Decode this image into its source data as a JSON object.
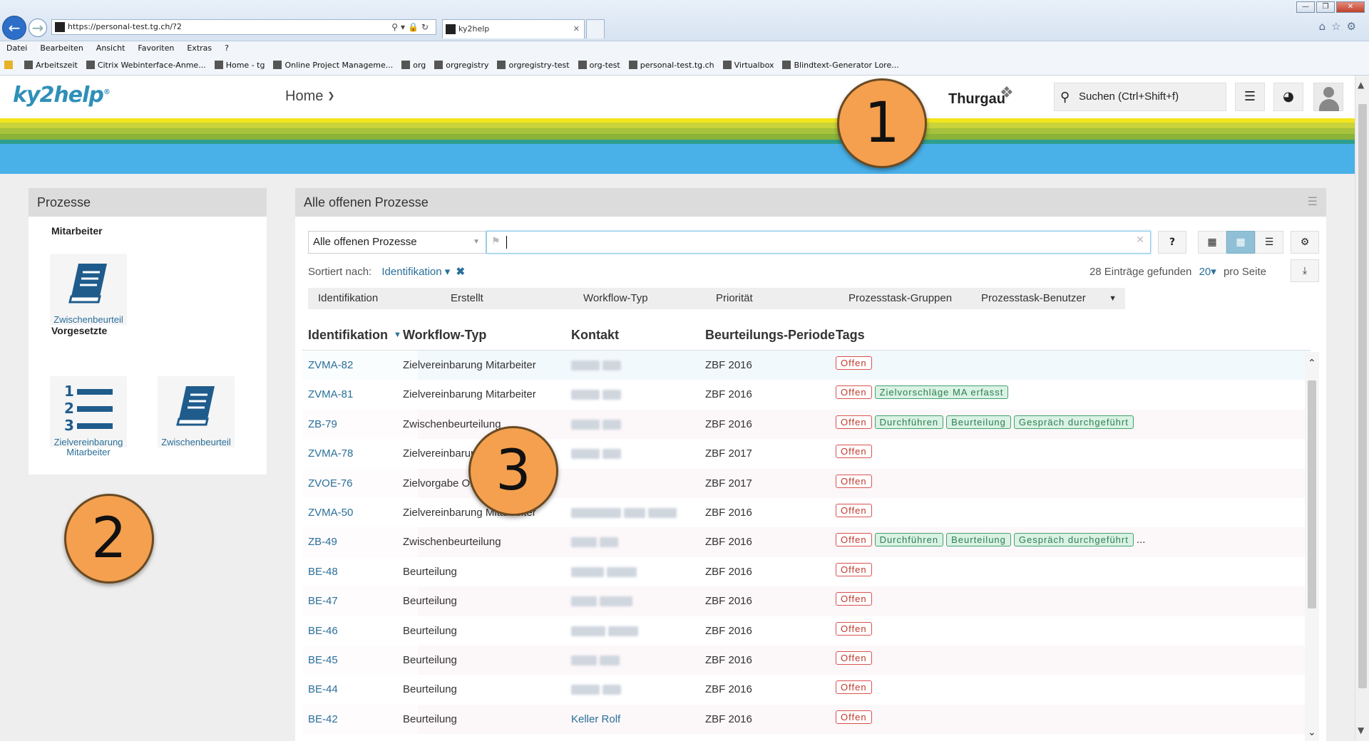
{
  "browser": {
    "url": "https://personal-test.tg.ch/?2",
    "tab_title": "ky2help",
    "menu": [
      "Datei",
      "Bearbeiten",
      "Ansicht",
      "Favoriten",
      "Extras",
      "?"
    ],
    "favorites": [
      "Arbeitszeit",
      "Citrix Webinterface-Anme...",
      "Home - tg",
      "Online Project Manageme...",
      "org",
      "orgregistry",
      "orgregistry-test",
      "org-test",
      "personal-test.tg.ch",
      "Virtualbox",
      "Blindtext-Generator Lore..."
    ]
  },
  "header": {
    "logo": "ky2help",
    "logo_reg": "®",
    "home_label": "Home",
    "brand": "Thurgau",
    "search_placeholder": "Suchen (Ctrl+Shift+f)"
  },
  "left_panel": {
    "title": "Prozesse",
    "group_employee": "Mitarbeiter",
    "group_manager": "Vorgesetzte",
    "tile_employee": "Zwischenbeurteil",
    "tile_manager_1_line1": "Zielvereinbarung",
    "tile_manager_1_line2": "Mitarbeiter",
    "tile_manager_2": "Zwischenbeurteil"
  },
  "main_panel": {
    "title": "Alle offenen Prozesse",
    "filter_value": "Alle offenen Prozesse",
    "sort_label": "Sortiert nach:",
    "sort_value": "Identifikation",
    "count_text": "28 Einträge gefunden",
    "per_page_value": "20",
    "per_page_label": "pro Seite",
    "help_btn": "?",
    "filters": [
      "Identifikation",
      "Erstellt",
      "Workflow-Typ",
      "Priorität",
      "Prozesstask-Gruppen",
      "Prozesstask-Benutzer"
    ],
    "columns": [
      "Identifikation",
      "Workflow-Typ",
      "Kontakt",
      "Beurteilungs-Periode",
      "Tags"
    ],
    "rows": [
      {
        "id": "ZVMA-82",
        "type": "Zielvereinbarung Mitarbeiter",
        "contact": "",
        "period": "ZBF 2016",
        "tags": [
          "Offen"
        ]
      },
      {
        "id": "ZVMA-81",
        "type": "Zielvereinbarung Mitarbeiter",
        "contact": "",
        "period": "ZBF 2016",
        "tags": [
          "Offen",
          "Zielvorschläge MA erfasst"
        ]
      },
      {
        "id": "ZB-79",
        "type": "Zwischenbeurteilung",
        "contact": "",
        "period": "ZBF 2016",
        "tags": [
          "Offen",
          "Durchführen",
          "Beurteilung",
          "Gespräch durchgeführt"
        ]
      },
      {
        "id": "ZVMA-78",
        "type": "Zielvereinbarung Mitarbeiter",
        "contact": "",
        "period": "ZBF 2017",
        "tags": [
          "Offen"
        ]
      },
      {
        "id": "ZVOE-76",
        "type": "Zielvorgabe OE",
        "contact": "",
        "period": "ZBF 2017",
        "tags": [
          "Offen"
        ]
      },
      {
        "id": "ZVMA-50",
        "type": "Zielvereinbarung Mitarbeiter",
        "contact": "",
        "period": "ZBF 2016",
        "tags": [
          "Offen"
        ]
      },
      {
        "id": "ZB-49",
        "type": "Zwischenbeurteilung",
        "contact": "",
        "period": "ZBF 2016",
        "tags": [
          "Offen",
          "Durchführen",
          "Beurteilung",
          "Gespräch durchgeführt"
        ],
        "truncated": "..."
      },
      {
        "id": "BE-48",
        "type": "Beurteilung",
        "contact": "",
        "period": "ZBF 2016",
        "tags": [
          "Offen"
        ]
      },
      {
        "id": "BE-47",
        "type": "Beurteilung",
        "contact": "",
        "period": "ZBF 2016",
        "tags": [
          "Offen"
        ]
      },
      {
        "id": "BE-46",
        "type": "Beurteilung",
        "contact": "",
        "period": "ZBF 2016",
        "tags": [
          "Offen"
        ]
      },
      {
        "id": "BE-45",
        "type": "Beurteilung",
        "contact": "",
        "period": "ZBF 2016",
        "tags": [
          "Offen"
        ]
      },
      {
        "id": "BE-44",
        "type": "Beurteilung",
        "contact": "",
        "period": "ZBF 2016",
        "tags": [
          "Offen"
        ]
      },
      {
        "id": "BE-42",
        "type": "Beurteilung",
        "contact": "Keller Rolf",
        "period": "ZBF 2016",
        "tags": [
          "Offen"
        ]
      }
    ]
  },
  "callouts": [
    "1",
    "2",
    "3"
  ],
  "colors": {
    "accent": "#2a6f99",
    "stripe_yellow": "#f2e51c",
    "stripe_light_green": "#c9d33a",
    "stripe_green": "#8bb33a",
    "stripe_teal": "#2e9e8f",
    "stripe_blue": "#4ab0e8",
    "callout": "#f4a04f"
  }
}
